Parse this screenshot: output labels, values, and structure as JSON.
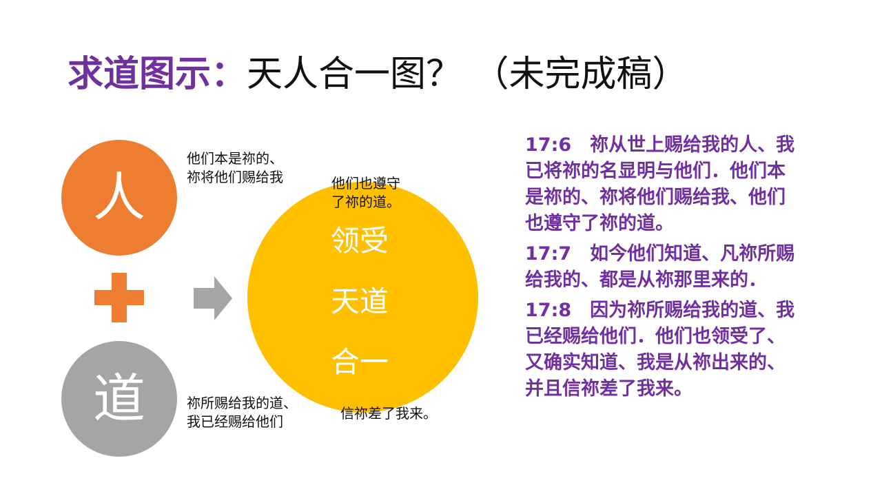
{
  "title": {
    "strong": "求道图示：",
    "rest": "天人合一图？ （未完成稿）"
  },
  "diagram": {
    "ren_label": "人",
    "dao_label": "道",
    "big_circle_lines": [
      "领受",
      "天道",
      "合一"
    ],
    "notes": [
      [
        "他们本是祢的、",
        "祢将他们赐给我"
      ],
      [
        "他们也遵守",
        "了祢的道。"
      ],
      [
        "祢所赐给我的道、",
        "我已经赐给他们"
      ],
      [
        "信祢差了我来。"
      ]
    ],
    "colors": {
      "orange": "#ed7d31",
      "gray": "#a5a5a5",
      "gold": "#ffc000",
      "arrow": "#a5a5a5"
    }
  },
  "verses": [
    {
      "lines": [
        "17:6　祢从世上赐给我的人、我",
        "已将祢的名显明与他们．他们本",
        "是祢的、祢将他们赐给我、他们",
        "也遵守了祢的道。"
      ]
    },
    {
      "lines": [
        "17:7　如今他们知道、凡祢所赐",
        "给我的、都是从祢那里来的．"
      ]
    },
    {
      "lines": [
        "17:8　因为祢所赐给我的道、我",
        "已经赐给他们．他们也领受了、",
        "又确实知道、我是从祢出来的、",
        "并且信祢差了我来。"
      ]
    }
  ],
  "theme": {
    "accent": "#7030a0"
  }
}
